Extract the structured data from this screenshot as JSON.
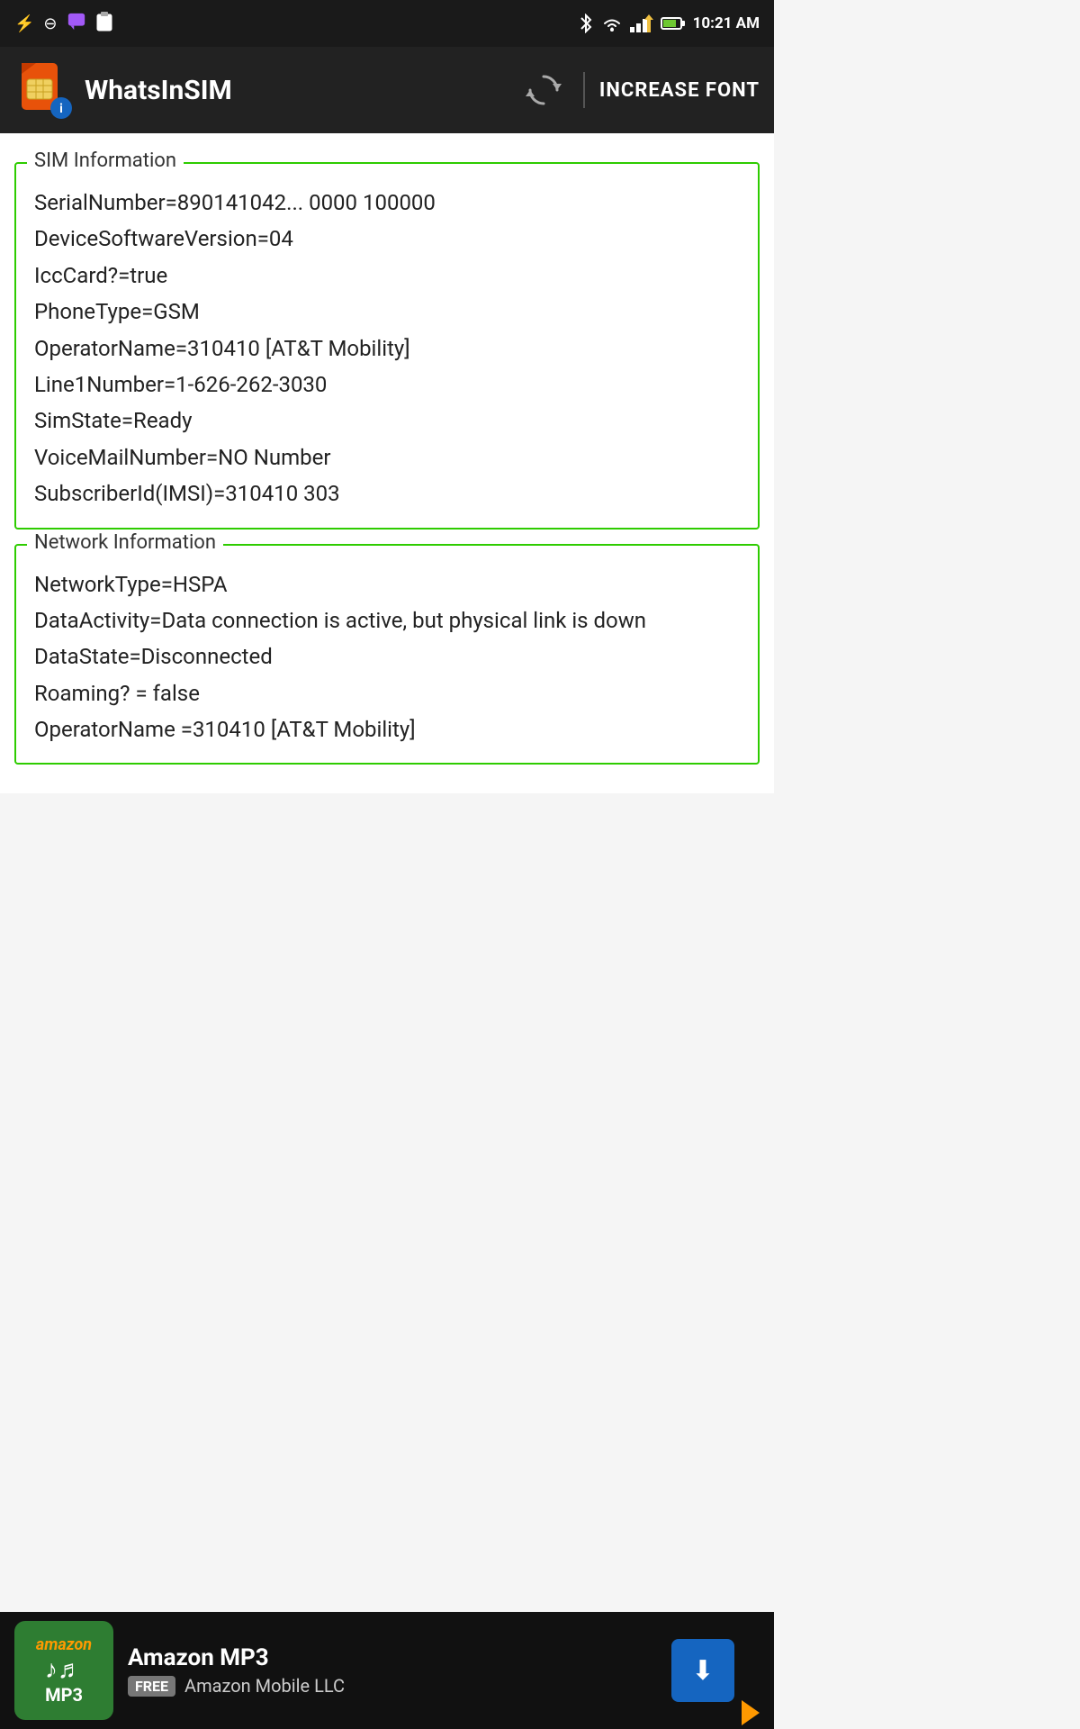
{
  "statusBar": {
    "time": "10:21 AM",
    "icons": {
      "usb": "⚡",
      "minus": "⊖",
      "chat": "💬",
      "clipboard": "📋",
      "bluetooth": "⚡",
      "wifi": "📶",
      "signal": "📶",
      "battery": "🔋"
    }
  },
  "appBar": {
    "title": "WhatsInSIM",
    "refreshLabel": "↻",
    "increaseFontLabel": "INCREASE FONT"
  },
  "simInfo": {
    "sectionLabel": "SIM Information",
    "lines": [
      "SerialNumber=890141042... 0000 100000",
      "DeviceSoftwareVersion=04",
      "IccCard?=true",
      "PhoneType=GSM",
      "OperatorName=310410 [AT&T Mobility]",
      "Line1Number=1-626-262-3030",
      "SimState=Ready",
      "VoiceMailNumber=NO Number",
      "SubscriberId(IMSI)=310410           303"
    ]
  },
  "networkInfo": {
    "sectionLabel": "Network Information",
    "lines": [
      "NetworkType=HSPA",
      "DataActivity=Data connection is active, but physical link is down",
      "DataState=Disconnected",
      "Roaming? = false",
      "OperatorName =310410 [AT&T Mobility]"
    ]
  },
  "adBanner": {
    "logoAmazon": "amazon",
    "logoMP3": "MP3",
    "title": "Amazon MP3",
    "freeBadge": "FREE",
    "subtitle": "Amazon Mobile LLC",
    "downloadIcon": "⬇"
  }
}
